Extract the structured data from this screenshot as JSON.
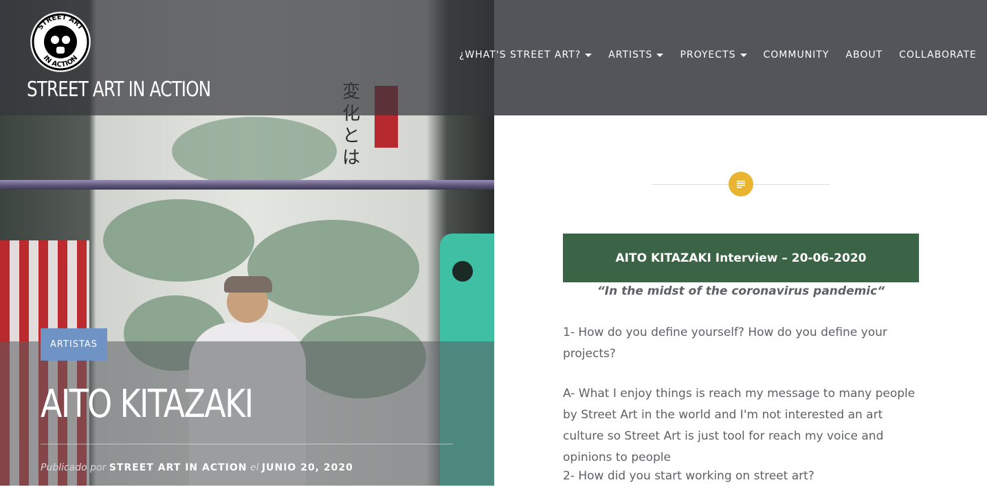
{
  "site": {
    "logo_text": "STREET ART IN ACTION",
    "title": "STREET ART IN ACTION"
  },
  "nav": {
    "items": [
      {
        "label": "¿WHAT'S STREET ART?",
        "has_dropdown": true
      },
      {
        "label": "ARTISTS",
        "has_dropdown": true
      },
      {
        "label": "PROYECTS",
        "has_dropdown": true
      },
      {
        "label": "COMMUNITY",
        "has_dropdown": false
      },
      {
        "label": "ABOUT",
        "has_dropdown": false
      },
      {
        "label": "COLLABORATE",
        "has_dropdown": false
      }
    ]
  },
  "hero": {
    "mural_text": "変化とは",
    "category": "ARTISTAS",
    "post_title": "AITO KITAZAKI",
    "meta": {
      "published_by_prefix": "Publicado por",
      "author": "STREET ART IN ACTION",
      "connector": "el",
      "date": "JUNIO 20, 2020"
    }
  },
  "content": {
    "format_icon": "document-icon",
    "interview_title": "AITO KITAZAKI Interview – 20-06-2020",
    "quote": "“In the midst of the coronavirus pandemic“",
    "paragraphs": [
      "1- How do you define yourself? How do you define your projects?",
      "A- What I enjoy things is reach my message to many people by Street Art in the world and I'm not interested an art culture so Street Art is just tool for reach my voice and opinions to people",
      "2- How did you start working on street art?"
    ]
  },
  "colors": {
    "header_bg": "#54555b",
    "badge": "#6e93c4",
    "accent_yellow": "#e9b430",
    "interview_box": "#3b6446",
    "body_text": "#5e6066"
  }
}
